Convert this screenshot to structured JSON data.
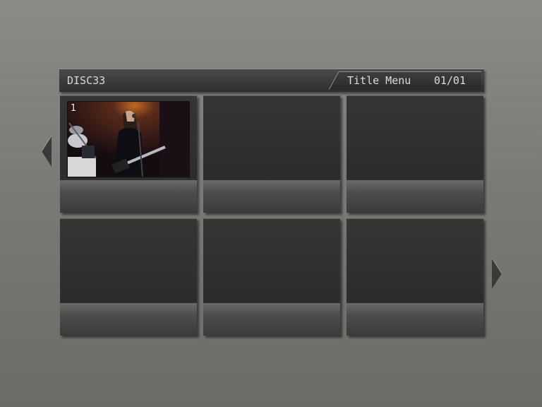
{
  "header": {
    "disc_label": "DISC33",
    "menu_title": "Title Menu",
    "page_indicator": "01/01"
  },
  "navigation": {
    "prev_icon": "left-triangle-icon",
    "next_icon": "right-triangle-icon"
  },
  "tiles": [
    {
      "number": "1",
      "has_thumbnail": true
    },
    {
      "number": "",
      "has_thumbnail": false
    },
    {
      "number": "",
      "has_thumbnail": false
    },
    {
      "number": "",
      "has_thumbnail": false
    },
    {
      "number": "",
      "has_thumbnail": false
    },
    {
      "number": "",
      "has_thumbnail": false
    }
  ],
  "colors": {
    "background": "#7a7b77",
    "header_bar": "#343533",
    "tile_dark": "#2f302e",
    "text": "#dcdcd8"
  }
}
